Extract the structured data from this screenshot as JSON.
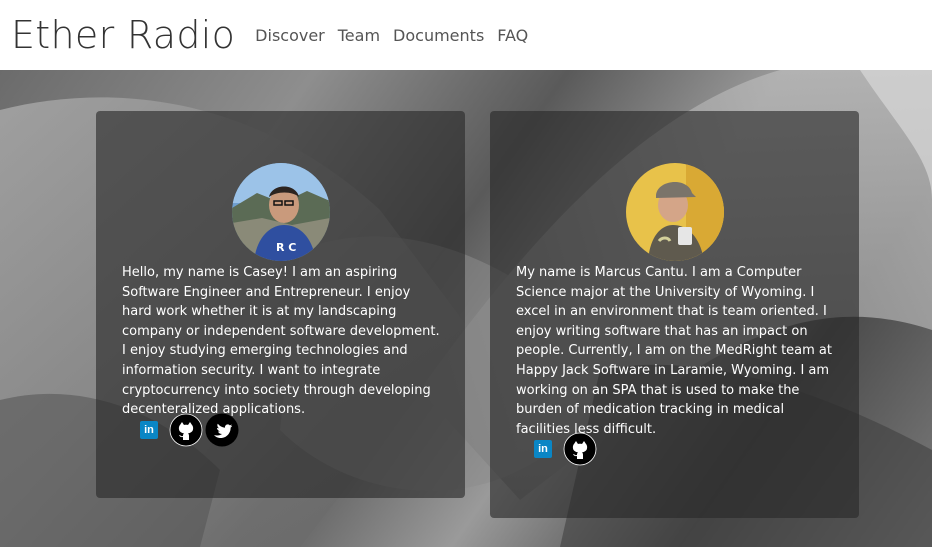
{
  "nav": {
    "brand": "Ether Radio",
    "links": [
      "Discover",
      "Team",
      "Documents",
      "FAQ"
    ]
  },
  "team": [
    {
      "name": "Casey",
      "bio": "Hello, my name is Casey! I am an aspiring Software Engineer and Entrepreneur. I enjoy hard work whether it is at my landscaping company or independent software development. I enjoy studying emerging technologies and information security. I want to integrate cryptocurrency into society through developing decenteralized applications.",
      "socials": [
        "linkedin-icon",
        "github-icon",
        "twitter-icon"
      ],
      "linkedin_label": "in"
    },
    {
      "name": "Marcus",
      "bio": "My name is Marcus Cantu. I am a Computer Science major at the University of Wyoming. I excel in an environment that is team oriented. I enjoy writing software that has an impact on people. Currently, I am on the MedRight team at Happy Jack Software in Laramie, Wyoming. I am working on an SPA that is used to make the burden of medication tracking in medical facilities less difficult.",
      "socials": [
        "linkedin-icon",
        "github-icon"
      ],
      "linkedin_label": "in"
    }
  ],
  "colors": {
    "linkedin": "#0a86c5",
    "card_bg": "rgba(40,40,40,0.62)",
    "text": "#ffffff"
  }
}
